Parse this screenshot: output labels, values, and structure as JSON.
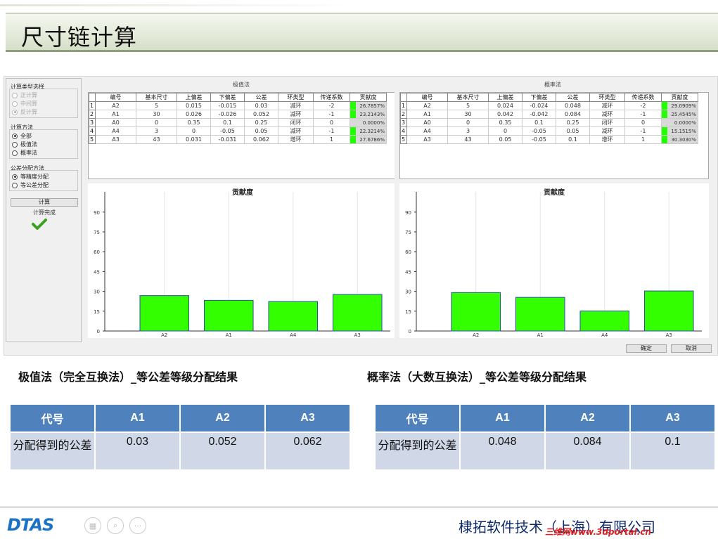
{
  "slide_title": "尺寸链计算",
  "left_panel": {
    "calc_type": {
      "title": "计算类型选择",
      "options": [
        "正计算",
        "中间算",
        "反计算"
      ],
      "selected": 2,
      "disabled": true
    },
    "calc_method": {
      "title": "计算方法",
      "options": [
        "全部",
        "极值法",
        "概率法"
      ],
      "selected": 0
    },
    "tol_method": {
      "title": "公差分配方法",
      "options": [
        "等精度分配",
        "等公差分配"
      ],
      "selected": 0
    },
    "calc_button": "计算",
    "status": "计算完成"
  },
  "extreme": {
    "title": "极值法",
    "headers": [
      "编号",
      "基本尺寸",
      "上偏差",
      "下偏差",
      "公差",
      "环类型",
      "传递系数",
      "贡献度"
    ],
    "rows": [
      {
        "n": "1",
        "cells": [
          "A2",
          "5",
          "0.015",
          "-0.015",
          "0.03",
          "减环",
          "-2"
        ],
        "pct": "26.7857%",
        "frac": 0.268
      },
      {
        "n": "2",
        "cells": [
          "A1",
          "30",
          "0.026",
          "-0.026",
          "0.052",
          "减环",
          "-1"
        ],
        "pct": "23.2143%",
        "frac": 0.232
      },
      {
        "n": "3",
        "cells": [
          "A0",
          "0",
          "0.35",
          "0.1",
          "0.25",
          "闭环",
          "0"
        ],
        "pct": "0.0000%",
        "frac": 0
      },
      {
        "n": "4",
        "cells": [
          "A4",
          "3",
          "0",
          "-0.05",
          "0.05",
          "减环",
          "-1"
        ],
        "pct": "22.3214%",
        "frac": 0.223
      },
      {
        "n": "5",
        "cells": [
          "A3",
          "43",
          "0.031",
          "-0.031",
          "0.062",
          "增环",
          "1"
        ],
        "pct": "27.6786%",
        "frac": 0.277
      }
    ]
  },
  "prob": {
    "title": "概率法",
    "headers": [
      "编号",
      "基本尺寸",
      "上偏差",
      "下偏差",
      "公差",
      "环类型",
      "传递系数",
      "贡献度"
    ],
    "rows": [
      {
        "n": "1",
        "cells": [
          "A2",
          "5",
          "0.024",
          "-0.024",
          "0.048",
          "减环",
          "-2"
        ],
        "pct": "29.0909%",
        "frac": 0.291
      },
      {
        "n": "2",
        "cells": [
          "A1",
          "30",
          "0.042",
          "-0.042",
          "0.084",
          "减环",
          "-1"
        ],
        "pct": "25.4545%",
        "frac": 0.255
      },
      {
        "n": "3",
        "cells": [
          "A0",
          "0",
          "0.35",
          "0.1",
          "0.25",
          "闭环",
          "0"
        ],
        "pct": "0.0000%",
        "frac": 0
      },
      {
        "n": "4",
        "cells": [
          "A4",
          "3",
          "0",
          "-0.05",
          "0.05",
          "减环",
          "-1"
        ],
        "pct": "15.1515%",
        "frac": 0.152
      },
      {
        "n": "5",
        "cells": [
          "A3",
          "43",
          "0.05",
          "-0.05",
          "0.1",
          "增环",
          "1"
        ],
        "pct": "30.3030%",
        "frac": 0.303
      }
    ]
  },
  "chart_data": [
    {
      "type": "bar",
      "title": "贡献度",
      "categories": [
        "A2",
        "A1",
        "A4",
        "A3"
      ],
      "values": [
        26.79,
        23.21,
        22.32,
        27.68
      ],
      "ylim": [
        0,
        100
      ],
      "yticks": [
        0,
        15,
        30,
        45,
        60,
        75,
        90
      ],
      "bar_color": "#33ff00"
    },
    {
      "type": "bar",
      "title": "贡献度",
      "categories": [
        "A2",
        "A1",
        "A4",
        "A3"
      ],
      "values": [
        29.09,
        25.45,
        15.15,
        30.3
      ],
      "ylim": [
        0,
        100
      ],
      "yticks": [
        0,
        15,
        30,
        45,
        60,
        75,
        90
      ],
      "bar_color": "#33ff00"
    }
  ],
  "buttons": {
    "ok": "确定",
    "cancel": "取消"
  },
  "results": {
    "extreme_label": "极值法（完全互换法）_等公差等级分配结果",
    "prob_label": "概率法（大数互换法）_等公差等级分配结果",
    "extreme": {
      "headers": [
        "代号",
        "A1",
        "A2",
        "A3"
      ],
      "row_label": "分配得到的公差",
      "values": [
        "0.03",
        "0.052",
        "0.062"
      ]
    },
    "prob": {
      "headers": [
        "代号",
        "A1",
        "A2",
        "A3"
      ],
      "row_label": "分配得到的公差",
      "values": [
        "0.048",
        "0.084",
        "0.1"
      ]
    }
  },
  "footer": {
    "logo": "DTAS",
    "company": "棣拓软件技术（上海）有限公司",
    "watermark": "三维网www.3dportal.cn"
  }
}
